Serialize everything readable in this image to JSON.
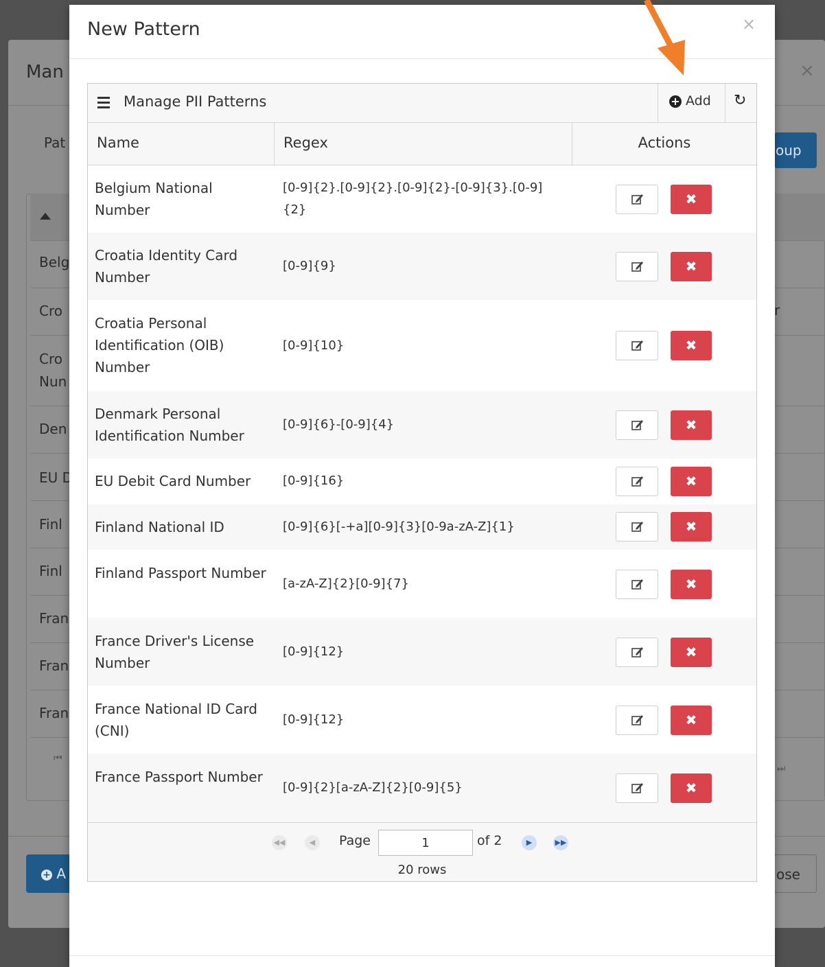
{
  "background": {
    "title_partial": "Man",
    "close_icon": "×",
    "pattern_label_partial": "Pat",
    "group_button_partial": "oup",
    "rows_partial": [
      "Belg",
      "Cro",
      "Cro",
      "Nun",
      "Den",
      "EU D",
      "Finl",
      "Finl",
      "Fran",
      "Fran",
      "Fran"
    ],
    "stray_text": "r",
    "add_button_partial": "A",
    "close_button_partial": "ose"
  },
  "modal": {
    "title": "New Pattern",
    "close_icon": "×"
  },
  "grid": {
    "title": "Manage PII Patterns",
    "add_label": "Add",
    "refresh_icon": "refresh-icon",
    "columns": {
      "name": "Name",
      "regex": "Regex",
      "actions": "Actions"
    },
    "rows": [
      {
        "name": "Belgium National Number",
        "regex": "[0-9]{2}.[0-9]{2}.[0-9]{2}-[0-9]{3}.[0-9]{2}"
      },
      {
        "name": "Croatia Identity Card Number",
        "regex": "[0-9]{9}"
      },
      {
        "name": "Croatia Personal Identification (OIB) Number",
        "regex": "[0-9]{10}"
      },
      {
        "name": "Denmark Personal Identification Number",
        "regex": "[0-9]{6}-[0-9]{4}"
      },
      {
        "name": "EU Debit Card Number",
        "regex": "[0-9]{16}"
      },
      {
        "name": "Finland National ID",
        "regex": "[0-9]{6}[-+a][0-9]{3}[0-9a-zA-Z]{1}"
      },
      {
        "name": "Finland Passport Number",
        "regex": "[a-zA-Z]{2}[0-9]{7}"
      },
      {
        "name": "France Driver's License Number",
        "regex": "[0-9]{12}"
      },
      {
        "name": "France National ID Card (CNI)",
        "regex": "[0-9]{12}"
      },
      {
        "name": "France Passport Number",
        "regex": "[0-9]{2}[a-zA-Z]{2}[0-9]{5}"
      }
    ],
    "delete_icon": "✖",
    "pager": {
      "page_label": "Page",
      "page_value": "1",
      "of_label": "of 2",
      "rows_label": "20 rows"
    }
  },
  "colors": {
    "delete_button": "#d9434b",
    "annotation_arrow": "#f07f2c"
  }
}
